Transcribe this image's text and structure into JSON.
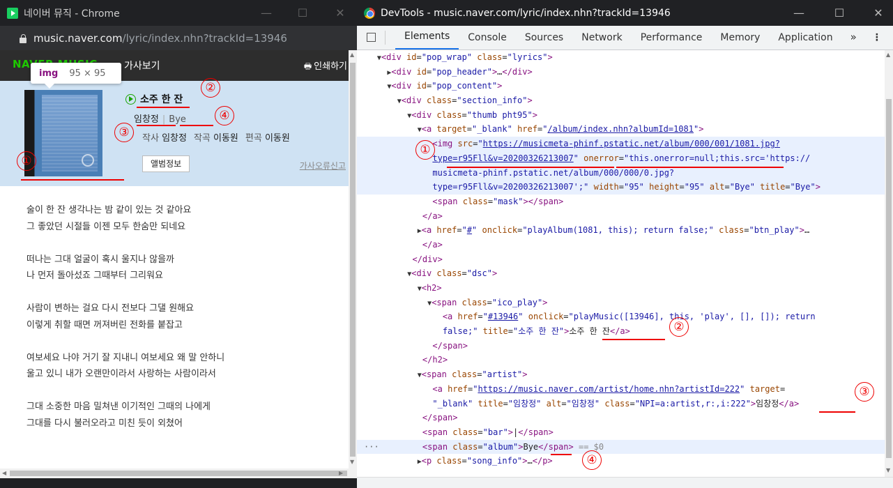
{
  "left_window": {
    "title": "네이버 뮤직 - Chrome",
    "url_host": "music.naver.com",
    "url_path": "/lyric/index.nhn?trackId=13946",
    "brand": "NAVER MUSIC",
    "lyrics_title": "가사보기",
    "print_label": "인쇄하기",
    "tooltip": {
      "tag": "img",
      "dims": "95 × 95"
    },
    "song_title": "소주 한 잔",
    "artist": "임창정",
    "bar": "|",
    "album": "Bye",
    "credits": {
      "lyricist_label": "작사",
      "lyricist": "임창정",
      "composer_label": "작곡",
      "composer": "이동원",
      "arranger_label": "편곡",
      "arranger": "이동원"
    },
    "album_info_button": "앨범정보",
    "report_link": "가사오류신고",
    "lyrics": [
      [
        "술이 한 잔 생각나는 밤 같이 있는 것 같아요",
        "그 좋았던 시절들 이젠 모두 한숨만 되네요"
      ],
      [
        "떠나는 그대 얼굴이 혹시 울지나 않을까",
        "나 먼저 돌아섰죠 그때부터 그리워요"
      ],
      [
        "사람이 변하는 걸요 다시 전보다 그댈 원해요",
        "이렇게 취할 때면 꺼져버린 전화를 붙잡고"
      ],
      [
        "여보세요 나야 거기 잘 지내니 여보세요 왜 말 안하니",
        "울고 있니 내가 오랜만이라서 사랑하는 사람이라서"
      ],
      [
        "그대 소중한 마음 밀쳐낸 이기적인 그때의 나에게",
        "그대를 다시 불러오라고 미친 듯이 외쳤어"
      ]
    ]
  },
  "right_window": {
    "title": "DevTools - music.naver.com/lyric/index.nhn?trackId=13946",
    "tabs": [
      "Elements",
      "Console",
      "Sources",
      "Network",
      "Performance",
      "Memory",
      "Application"
    ],
    "more_tabs": "»",
    "menu": "⋮",
    "selected_suffix": "== $0",
    "tree_text": {
      "pop_wrap_id": "pop_wrap",
      "lyrics_cls": "lyrics",
      "pop_header": "pop_header",
      "pop_content": "pop_content",
      "section_info": "section_info",
      "thumb_cls": "thumb pht95",
      "blank": "_blank",
      "album_href": "/album/index.nhn?albumId=1081",
      "img_src_1": "https://musicmeta-phinf.pstatic.net/album/000/001/1081.jpg?",
      "img_src_2": "type=r95Fll&v=20200326213007",
      "onerror_1": "this.onerror=null;this.src='https://",
      "onerror_2": "musicmeta-phinf.pstatic.net/album/000/000/0.jpg?",
      "onerror_3": "type=r95Fll&v=20200326213007';",
      "width": "95",
      "height": "95",
      "alt": "Bye",
      "title": "Bye",
      "mask": "mask",
      "hash": "#",
      "play_album": "playAlbum(1081, this); return false;",
      "btn_play": "btn_play",
      "dsc": "dsc",
      "ico_play": "ico_play",
      "track_href": "#13946",
      "play_music_1": "playMusic([13946], this, 'play', [], []); return",
      "play_music_2": "false;",
      "song_title": "소주 한 잔",
      "artist_cls": "artist",
      "artist_href": "https://music.naver.com/artist/home.nhn?artistId=222",
      "artist_target_2": "_blank",
      "artist_name": "임창정",
      "npi": "NPI=a:artist,r:,i:222",
      "bar_cls": "bar",
      "bar_text": "|",
      "album_cls": "album",
      "album_text": "Bye",
      "song_info": "song_info"
    }
  },
  "annotations": [
    "①",
    "②",
    "③",
    "④"
  ]
}
